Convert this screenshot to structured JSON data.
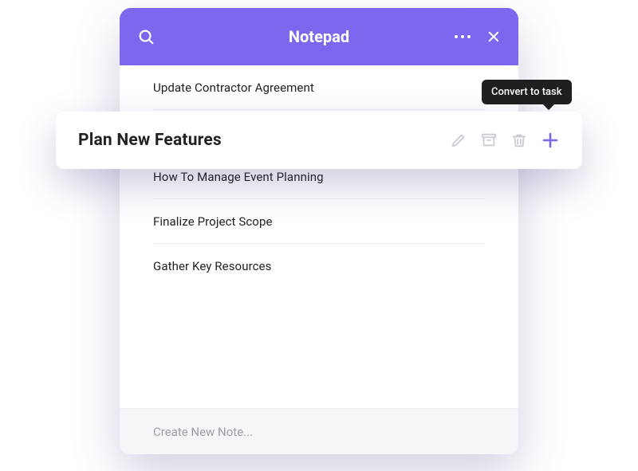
{
  "header": {
    "title": "Notepad"
  },
  "notes": [
    "Update Contractor Agreement",
    "How To Manage Event Planning",
    "Finalize Project Scope",
    "Gather Key Resources"
  ],
  "active_note": {
    "title": "Plan New Features"
  },
  "tooltip": {
    "convert": "Convert to task"
  },
  "footer": {
    "placeholder": "Create New Note..."
  },
  "colors": {
    "accent": "#7B68EE"
  }
}
